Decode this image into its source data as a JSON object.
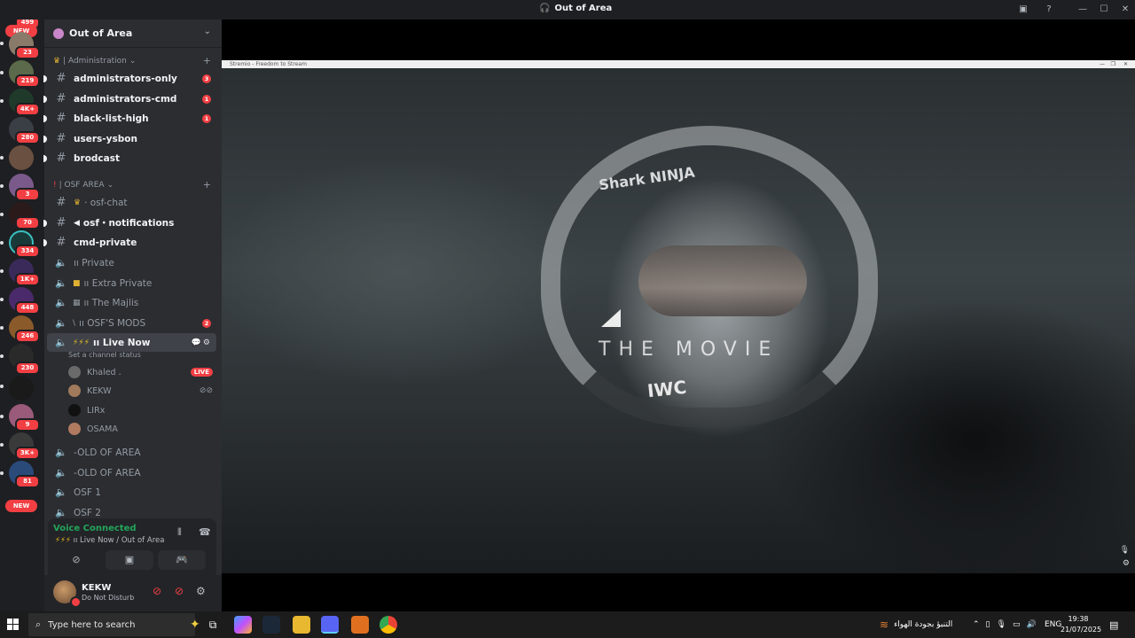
{
  "window": {
    "title": "Out of Area"
  },
  "server_rail": {
    "new_label": "NEW",
    "badges": [
      "23",
      "219",
      "4K+",
      "280",
      "3",
      "70",
      "334",
      "1K+",
      "448",
      "246",
      "230",
      "9",
      "3K+",
      "81"
    ],
    "top_badge": "499"
  },
  "guild": {
    "name": "Out of Area"
  },
  "categories": {
    "admin": "| Administration",
    "osf": "| OSF AREA"
  },
  "channels": {
    "administrators_only": {
      "name": "administrators-only",
      "mentions": "3"
    },
    "administrators_cmd": {
      "name": "administrators-cmd",
      "mentions": "1"
    },
    "black_list_high": {
      "name": "black-list-high",
      "mentions": "1"
    },
    "users_ysbon": {
      "name": "users-ysbon"
    },
    "brodcast": {
      "name": "brodcast"
    },
    "osf_chat": {
      "name": "· osf-chat"
    },
    "osf_notifications": {
      "name": "osf・notifications"
    },
    "cmd_private": {
      "name": "cmd-private"
    },
    "private": {
      "name": "ıı Private"
    },
    "extra_private": {
      "name": "ıı Extra Private"
    },
    "majlis": {
      "name": "ıı The Majlis"
    },
    "osf_mods": {
      "name": "ıı OSF'S MODS",
      "mentions": "2"
    },
    "live_now": {
      "name": "ıı Live Now",
      "status_placeholder": "Set a channel status"
    },
    "old_of_area_1": {
      "name": "-OLD OF AREA"
    },
    "old_of_area_2": {
      "name": "-OLD OF AREA"
    },
    "osf_1": {
      "name": "OSF 1"
    },
    "osf_2": {
      "name": "OSF 2"
    }
  },
  "voice_users": [
    {
      "name": "Khaled .",
      "badge": "LIVE"
    },
    {
      "name": "KEKW"
    },
    {
      "name": "LIRx"
    },
    {
      "name": "OSAMA"
    }
  ],
  "voice_panel": {
    "status": "Voice Connected",
    "location": "ıı Live Now / Out of Area"
  },
  "user_panel": {
    "username": "KEKW",
    "status": "Do Not Disturb"
  },
  "stream": {
    "window_title": "Stremio - Freedom to Stream",
    "logo_text": "THE MOVIE",
    "helmet_brand": "Shark NINJA",
    "sponsor": "IWC"
  },
  "taskbar": {
    "search_placeholder": "Type here to search",
    "weather": "التنبؤ بجودة الهواء",
    "language": "ENG",
    "time": "19:38",
    "date": "21/07/2025"
  },
  "colors": {
    "accent_red": "#f23f43",
    "voice_green": "#23a55a",
    "sidebar_bg": "#2b2d31"
  }
}
